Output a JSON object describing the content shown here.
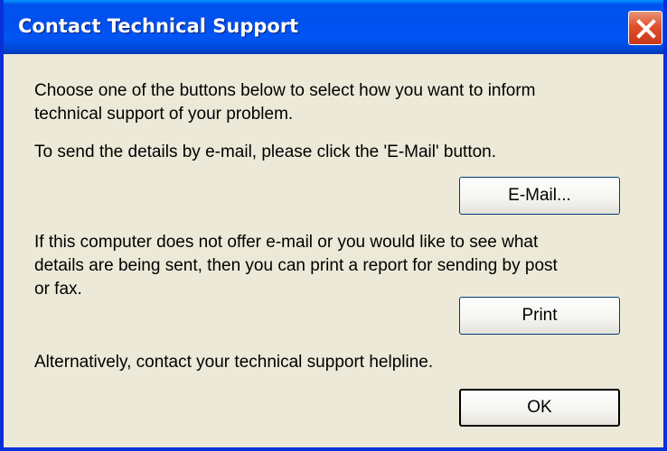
{
  "window": {
    "title": "Contact Technical Support"
  },
  "body": {
    "intro": "Choose one of the buttons below to select how you want to inform\ntechnical support of your problem.",
    "email_instruction": "To send the details by e-mail, please click the 'E-Mail' button.",
    "print_instruction": "If this computer does not offer e-mail or you would like to see what\ndetails are being sent, then you can print a report for sending by post\nor fax.",
    "helpline_note": "Alternatively, contact your technical support helpline."
  },
  "buttons": {
    "email_label": "E-Mail...",
    "print_label": "Print",
    "ok_label": "OK"
  },
  "colors": {
    "titlebar": "#0053ee",
    "close_button": "#e0502c",
    "dialog_background": "#ece9d8"
  },
  "icons": {
    "close": "close-x-icon"
  }
}
